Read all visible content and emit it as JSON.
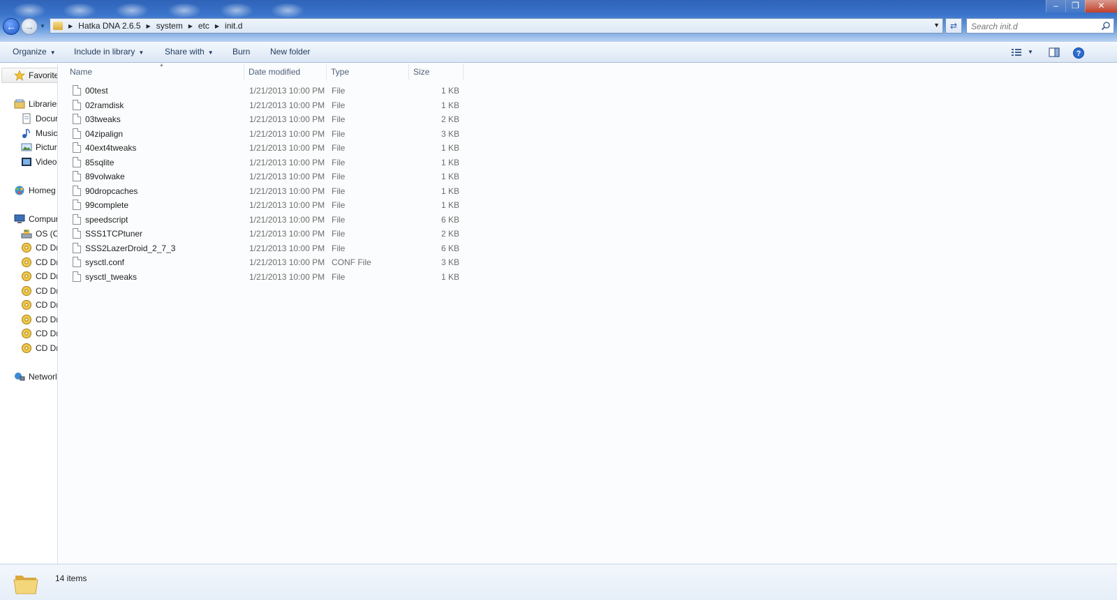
{
  "window": {
    "controls": {
      "minimize": "–",
      "maximize": "❐",
      "close": "✕"
    }
  },
  "nav": {
    "back_icon": "back-arrow-icon",
    "forward_icon": "forward-arrow-icon"
  },
  "address": {
    "crumbs": [
      "Hatka DNA 2.6.5",
      "system",
      "etc",
      "init.d"
    ]
  },
  "search": {
    "placeholder": "Search init.d"
  },
  "toolbar": {
    "organize": "Organize",
    "include_in_library": "Include in library",
    "share_with": "Share with",
    "burn": "Burn",
    "new_folder": "New folder"
  },
  "sidebar": {
    "favorites": "Favorite",
    "libraries": "Libraries",
    "documents": "Docur",
    "music": "Music",
    "pictures": "Pictur",
    "videos": "Video",
    "homegroup": "Homeg",
    "computer": "Compur",
    "os_drive": "OS (C",
    "cd_drives": [
      "CD Dr",
      "CD Dr",
      "CD Dr",
      "CD Dr",
      "CD Dr",
      "CD Dr",
      "CD Dr",
      "CD Dr"
    ],
    "network": "Networl"
  },
  "columns": {
    "name": "Name",
    "date": "Date modified",
    "type": "Type",
    "size": "Size"
  },
  "files": [
    {
      "name": "00test",
      "date": "1/21/2013 10:00 PM",
      "type": "File",
      "size": "1 KB"
    },
    {
      "name": "02ramdisk",
      "date": "1/21/2013 10:00 PM",
      "type": "File",
      "size": "1 KB"
    },
    {
      "name": "03tweaks",
      "date": "1/21/2013 10:00 PM",
      "type": "File",
      "size": "2 KB"
    },
    {
      "name": "04zipalign",
      "date": "1/21/2013 10:00 PM",
      "type": "File",
      "size": "3 KB"
    },
    {
      "name": "40ext4tweaks",
      "date": "1/21/2013 10:00 PM",
      "type": "File",
      "size": "1 KB"
    },
    {
      "name": "85sqlite",
      "date": "1/21/2013 10:00 PM",
      "type": "File",
      "size": "1 KB"
    },
    {
      "name": "89volwake",
      "date": "1/21/2013 10:00 PM",
      "type": "File",
      "size": "1 KB"
    },
    {
      "name": "90dropcaches",
      "date": "1/21/2013 10:00 PM",
      "type": "File",
      "size": "1 KB"
    },
    {
      "name": "99complete",
      "date": "1/21/2013 10:00 PM",
      "type": "File",
      "size": "1 KB"
    },
    {
      "name": "speedscript",
      "date": "1/21/2013 10:00 PM",
      "type": "File",
      "size": "6 KB"
    },
    {
      "name": "SSS1TCPtuner",
      "date": "1/21/2013 10:00 PM",
      "type": "File",
      "size": "2 KB"
    },
    {
      "name": "SSS2LazerDroid_2_7_3",
      "date": "1/21/2013 10:00 PM",
      "type": "File",
      "size": "6 KB"
    },
    {
      "name": "sysctl.conf",
      "date": "1/21/2013 10:00 PM",
      "type": "CONF File",
      "size": "3 KB"
    },
    {
      "name": "sysctl_tweaks",
      "date": "1/21/2013 10:00 PM",
      "type": "File",
      "size": "1 KB"
    }
  ],
  "status": {
    "item_count": "14 items"
  }
}
